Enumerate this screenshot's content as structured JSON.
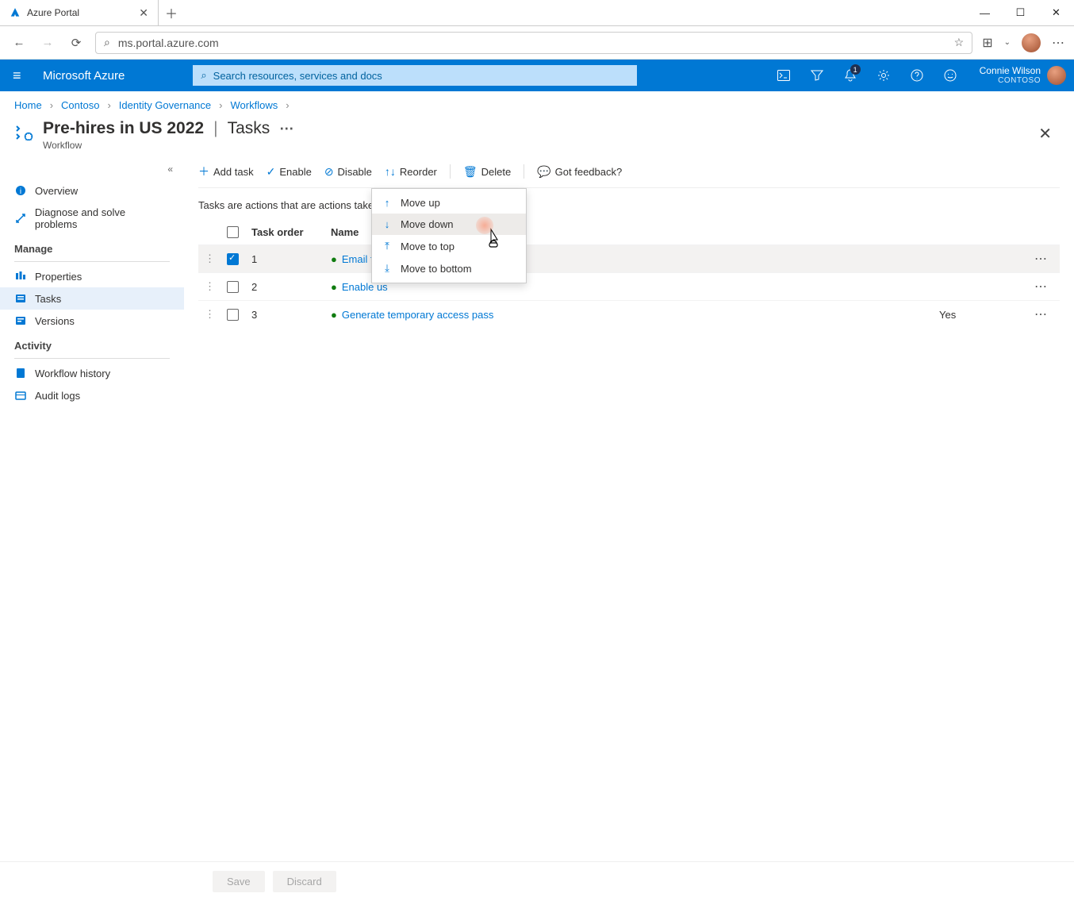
{
  "browser": {
    "tab_title": "Azure Portal",
    "url": "ms.portal.azure.com"
  },
  "azure_bar": {
    "brand": "Microsoft Azure",
    "search_placeholder": "Search resources, services and docs",
    "notification_badge": "1",
    "user_name": "Connie Wilson",
    "user_org": "CONTOSO"
  },
  "breadcrumbs": [
    "Home",
    "Contoso",
    "Identity Governance",
    "Workflows"
  ],
  "page": {
    "title": "Pre-hires in US 2022",
    "section": "Tasks",
    "subtitle": "Workflow"
  },
  "toolbar": {
    "add_task": "Add task",
    "enable": "Enable",
    "disable": "Disable",
    "reorder": "Reorder",
    "delete": "Delete",
    "feedback": "Got feedback?"
  },
  "description": "Tasks are actions that are actions taken on",
  "columns": {
    "order": "Task order",
    "name": "Name",
    "enabled": ""
  },
  "tasks": [
    {
      "order": "1",
      "name": "Email to h",
      "enabled": "",
      "selected": true
    },
    {
      "order": "2",
      "name": "Enable us",
      "enabled": "",
      "selected": false
    },
    {
      "order": "3",
      "name": "Generate temporary access pass",
      "enabled": "Yes",
      "selected": false
    }
  ],
  "reorder_menu": {
    "move_up": "Move up",
    "move_down": "Move down",
    "move_to_top": "Move to top",
    "move_to_bottom": "Move to bottom"
  },
  "sidenav": {
    "overview": "Overview",
    "diagnose": "Diagnose and solve problems",
    "group_manage": "Manage",
    "properties": "Properties",
    "tasks": "Tasks",
    "versions": "Versions",
    "group_activity": "Activity",
    "workflow_history": "Workflow history",
    "audit_logs": "Audit logs"
  },
  "footer": {
    "save": "Save",
    "discard": "Discard"
  }
}
